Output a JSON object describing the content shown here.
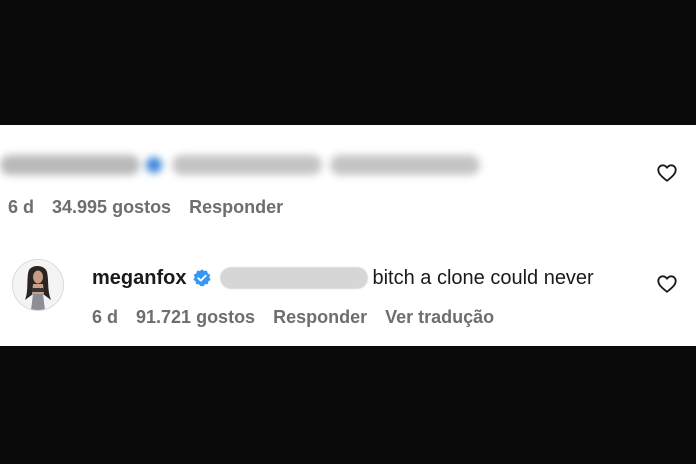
{
  "comments": [
    {
      "time": "6 d",
      "likes": "34.995 gostos",
      "reply": "Responder"
    },
    {
      "username": "meganfox",
      "verified": true,
      "text": "bitch a clone could never",
      "time": "6 d",
      "likes": "91.721 gostos",
      "reply": "Responder",
      "translate": "Ver tradução"
    }
  ],
  "icons": {
    "like": "heart-outline-icon",
    "verified": "verified-badge-icon"
  },
  "colors": {
    "background": "#0a0a0a",
    "panel": "#ffffff",
    "meta_text": "#6e6e6e",
    "verified": "#3897f0"
  }
}
